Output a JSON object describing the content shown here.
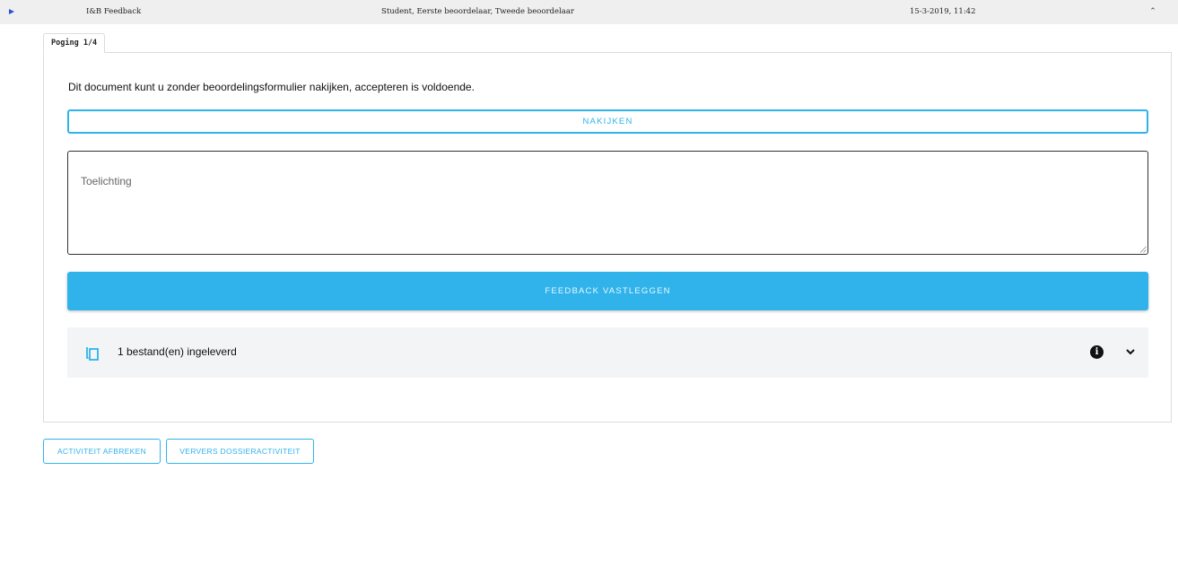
{
  "header": {
    "title": "I&B Feedback",
    "roles": "Student, Eerste beoordelaar, Tweede beoordelaar",
    "datetime": "15-3-2019, 11:42",
    "expand_icon": "chevron-up-icon",
    "toggle_icon": "play-triangle-icon",
    "accent_color": "#2a52d6"
  },
  "tab": {
    "label": "Poging 1/4"
  },
  "main": {
    "intro_text": "Dit document kunt u zonder beoordelingsformulier nakijken, accepteren is voldoende.",
    "review_button": "NAKIJKEN",
    "comment": {
      "placeholder": "Toelichting",
      "value": ""
    },
    "submit_button": "FEEDBACK VASTLEGGEN",
    "files": {
      "label": "1 bestand(en) ingeleverd",
      "icon": "copy-icon",
      "info_icon": "info-icon",
      "expand_icon": "chevron-down-icon"
    }
  },
  "footer": {
    "abort_button": "ACTIVITEIT AFBREKEN",
    "refresh_button": "VERVERS DOSSIERACTIVITEIT"
  },
  "colors": {
    "primary": "#2fb3ea",
    "panel_border": "#dcdcdc",
    "files_bg": "#f3f4f6"
  }
}
